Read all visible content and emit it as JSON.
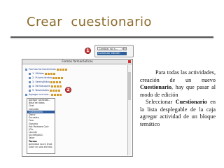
{
  "slide": {
    "title": "Crear  cuestionario",
    "para1": [
      "Para todas las actividades, creación de un nuevo ",
      "Cuestionario",
      ", hay que pasar al modo de edición"
    ],
    "para2": [
      "Seleccionar ",
      "Cuestionario",
      " en la lista desplegable de la caja agregar actividad de un bloque temático"
    ]
  },
  "mini_screenshot": {
    "select_value": "Cambiar rol a...",
    "bar_label": "Comenzar edición",
    "callout": "1"
  },
  "screenshot": {
    "window_title": "Formas farmacéuticas",
    "callout": "2",
    "tree_items": [
      {
        "label": "Formas farmacéuticas",
        "sub": false
      },
      {
        "label": "1. Sólidas",
        "sub": true
      },
      {
        "label": "2. Pulverulentas",
        "sub": true
      },
      {
        "label": "3. Semisólidas",
        "sub": true
      },
      {
        "label": "4. Farmacopea",
        "sub": true
      },
      {
        "label": "5. Novedades",
        "sub": true
      },
      {
        "label": "Agregar recurso...",
        "sub": false
      }
    ],
    "activity_select": "Agregar actividad...",
    "activity_options": [
      {
        "label": "Agregar actividad...",
        "type": "normal"
      },
      {
        "label": "Base de datos",
        "type": "normal"
      },
      {
        "label": "Chat",
        "type": "normal"
      },
      {
        "label": "Consulta",
        "type": "normal"
      },
      {
        "label": "Cuestionario",
        "type": "selected"
      },
      {
        "label": "Diario",
        "type": "normal"
      },
      {
        "label": "Encuesta",
        "type": "normal"
      },
      {
        "label": "Foro",
        "type": "normal"
      },
      {
        "label": "Glosario",
        "type": "normal"
      },
      {
        "label": "Hot Potatoes Quiz",
        "type": "normal"
      },
      {
        "label": "JClic",
        "type": "normal"
      },
      {
        "label": "Lección",
        "type": "normal"
      },
      {
        "label": "SCORM/AICC",
        "type": "normal"
      },
      {
        "label": "Taller",
        "type": "normal"
      },
      {
        "label": "Tareas",
        "type": "group"
      },
      {
        "label": "Actividad no en línea",
        "type": "normal"
      },
      {
        "label": "Subir un solo archivo",
        "type": "normal"
      }
    ]
  }
}
